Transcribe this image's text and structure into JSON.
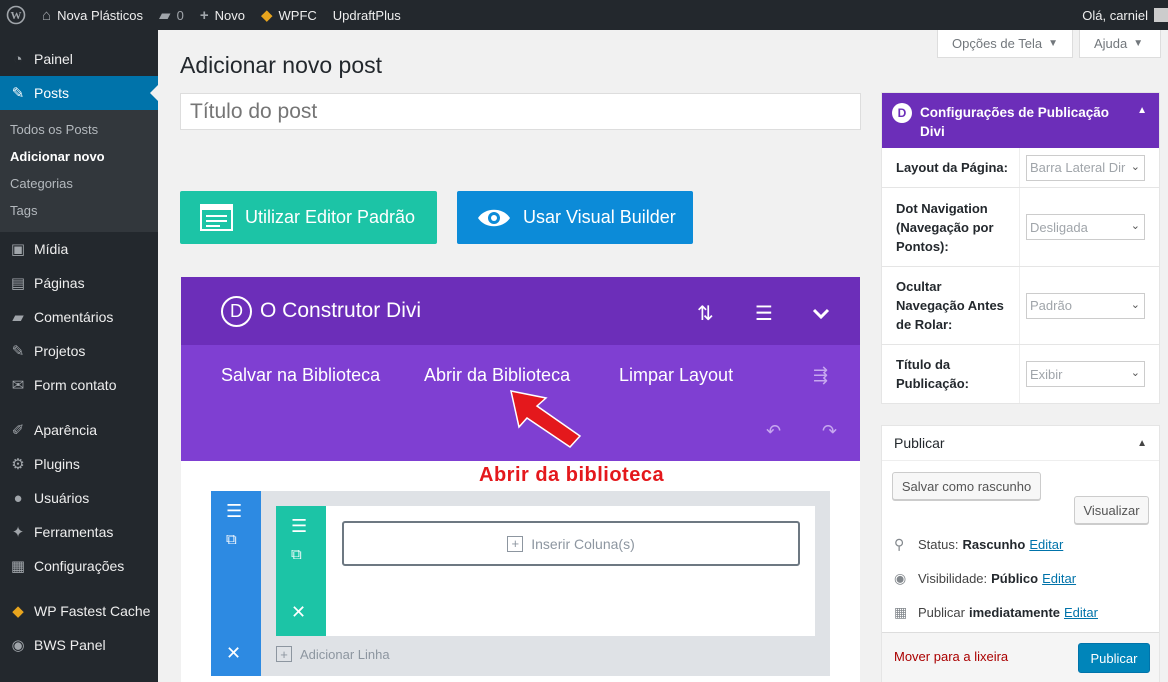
{
  "admin_bar": {
    "site_name": "Nova Plásticos",
    "comments_count": "0",
    "new_label": "Novo",
    "wpfc_label": "WPFC",
    "updraft_label": "UpdraftPlus",
    "greeting": "Olá, carniel"
  },
  "sidebar": {
    "items": [
      {
        "label": "Painel",
        "icon": "dashboard-icon"
      },
      {
        "label": "Posts",
        "icon": "pin-icon"
      },
      {
        "label": "Mídia",
        "icon": "media-icon"
      },
      {
        "label": "Páginas",
        "icon": "pages-icon"
      },
      {
        "label": "Comentários",
        "icon": "comments-icon"
      },
      {
        "label": "Projetos",
        "icon": "pin-icon"
      },
      {
        "label": "Form contato",
        "icon": "mail-icon"
      },
      {
        "label": "Aparência",
        "icon": "brush-icon"
      },
      {
        "label": "Plugins",
        "icon": "plugin-icon"
      },
      {
        "label": "Usuários",
        "icon": "user-icon"
      },
      {
        "label": "Ferramentas",
        "icon": "wrench-icon"
      },
      {
        "label": "Configurações",
        "icon": "settings-icon"
      },
      {
        "label": "WP Fastest Cache",
        "icon": "cheetah-icon"
      },
      {
        "label": "BWS Panel",
        "icon": "bws-icon"
      }
    ],
    "submenu": [
      "Todos os Posts",
      "Adicionar novo",
      "Categorias",
      "Tags"
    ]
  },
  "screen_options": {
    "options_label": "Opções de Tela",
    "help_label": "Ajuda"
  },
  "page": {
    "title": "Adicionar novo post",
    "title_placeholder": "Título do post",
    "btn_default_editor": "Utilizar Editor Padrão",
    "btn_visual_builder": "Usar Visual Builder"
  },
  "divi": {
    "title": "O Construtor Divi",
    "logo_letter": "D",
    "save_library": "Salvar na Biblioteca",
    "open_library": "Abrir da Biblioteca",
    "clear_layout": "Limpar Layout",
    "insert_column": "Inserir Coluna(s)",
    "add_row": "Adicionar Linha"
  },
  "annotation": {
    "text": "Abrir da biblioteca",
    "color": "#e4181c"
  },
  "divi_settings": {
    "title": "Configurações de Publicação Divi",
    "rows": [
      {
        "label": "Layout da Página:",
        "value": "Barra Lateral Dir"
      },
      {
        "label": "Dot Navigation (Navegação por Pontos):",
        "value": "Desligada"
      },
      {
        "label": "Ocultar Navegação Antes de Rolar:",
        "value": "Padrão"
      },
      {
        "label": "Título da Publicação:",
        "value": "Exibir"
      }
    ]
  },
  "publish": {
    "title": "Publicar",
    "save_draft": "Salvar como rascunho",
    "preview": "Visualizar",
    "status_label": "Status:",
    "status_value": "Rascunho",
    "visibility_label": "Visibilidade:",
    "visibility_value": "Público",
    "publish_label": "Publicar",
    "publish_value": "imediatamente",
    "edit": "Editar",
    "trash": "Mover para a lixeira",
    "publish_button": "Publicar"
  },
  "colors": {
    "admin_dark": "#23282d",
    "wp_blue": "#0073aa",
    "divi_purple": "#6c2eb9",
    "divi_purple_light": "#7f3fd2",
    "teal": "#1cc4a6",
    "blue_button": "#0c8bd8"
  }
}
